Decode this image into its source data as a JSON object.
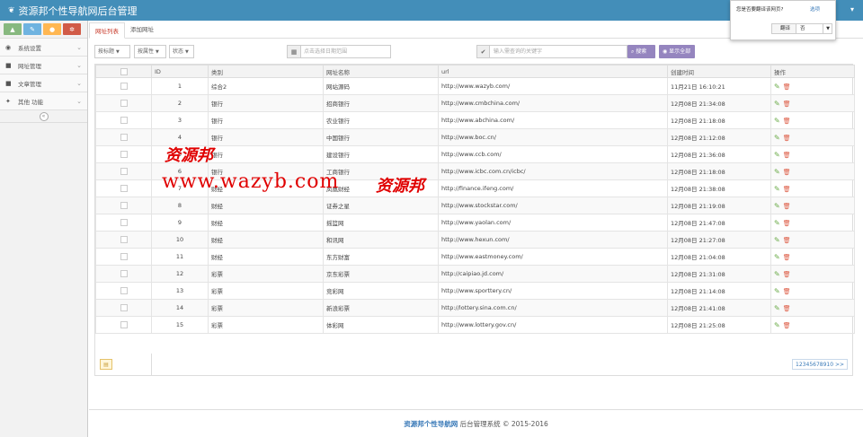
{
  "header": {
    "title": "资源邦个性导航网后台管理",
    "user_caret": "▾"
  },
  "sidebar": {
    "items": [
      {
        "label": "系统设置",
        "icon": "dashboard-icon"
      },
      {
        "label": "网址管理",
        "icon": "folder-icon"
      },
      {
        "label": "文章管理",
        "icon": "folder-icon"
      },
      {
        "label": "其他 功能",
        "icon": "wrench-icon"
      }
    ],
    "collapse_symbol": "«"
  },
  "tabs": [
    {
      "label": "网址列表",
      "active": true
    },
    {
      "label": "添加网址",
      "active": false
    }
  ],
  "filters": {
    "select1": "按标题",
    "select2": "按属性",
    "select3": "状态",
    "date_placeholder": "点击选择日期范围",
    "search_placeholder": "输入需查询的关键字",
    "search_button": "搜索",
    "show_all_button": "显示全部"
  },
  "table": {
    "headers": [
      "ID",
      "类别",
      "网址名称",
      "url",
      "创建时间",
      "操作"
    ],
    "rows": [
      {
        "id": "1",
        "cat": "综合2",
        "name": "网站源码",
        "url": "http://www.wazyb.com/",
        "time": "11月21日 16:10:21"
      },
      {
        "id": "2",
        "cat": "银行",
        "name": "招商银行",
        "url": "http://www.cmbchina.com/",
        "time": "12月08日 21:34:08"
      },
      {
        "id": "3",
        "cat": "银行",
        "name": "农业银行",
        "url": "http://www.abchina.com/",
        "time": "12月08日 21:18:08"
      },
      {
        "id": "4",
        "cat": "银行",
        "name": "中国银行",
        "url": "http://www.boc.cn/",
        "time": "12月08日 21:12:08"
      },
      {
        "id": "5",
        "cat": "银行",
        "name": "建设银行",
        "url": "http://www.ccb.com/",
        "time": "12月08日 21:36:08"
      },
      {
        "id": "6",
        "cat": "银行",
        "name": "工商银行",
        "url": "http://www.icbc.com.cn/icbc/",
        "time": "12月08日 21:18:08"
      },
      {
        "id": "7",
        "cat": "财经",
        "name": "凤凰财经",
        "url": "http://finance.ifeng.com/",
        "time": "12月08日 21:38:08"
      },
      {
        "id": "8",
        "cat": "财经",
        "name": "证券之星",
        "url": "http://www.stockstar.com/",
        "time": "12月08日 21:19:08"
      },
      {
        "id": "9",
        "cat": "财经",
        "name": "摇篮网",
        "url": "http://www.yaolan.com/",
        "time": "12月08日 21:47:08"
      },
      {
        "id": "10",
        "cat": "财经",
        "name": "和讯网",
        "url": "http://www.hexun.com/",
        "time": "12月08日 21:27:08"
      },
      {
        "id": "11",
        "cat": "财经",
        "name": "东方财富",
        "url": "http://www.eastmoney.com/",
        "time": "12月08日 21:04:08"
      },
      {
        "id": "12",
        "cat": "彩票",
        "name": "京东彩票",
        "url": "http://caipiao.jd.com/",
        "time": "12月08日 21:31:08"
      },
      {
        "id": "13",
        "cat": "彩票",
        "name": "竞彩网",
        "url": "http://www.sporttery.cn/",
        "time": "12月08日 21:14:08"
      },
      {
        "id": "14",
        "cat": "彩票",
        "name": "新浪彩票",
        "url": "http://lottery.sina.com.cn/",
        "time": "12月08日 21:41:08"
      },
      {
        "id": "15",
        "cat": "彩票",
        "name": "体彩网",
        "url": "http://www.lottery.gov.cn/",
        "time": "12月08日 21:25:08"
      }
    ]
  },
  "pager": "12345678910 >>",
  "footer": {
    "site": "资源邦个性导航网",
    "rest": "后台管理系统 © 2015-2016"
  },
  "watermark": {
    "url": "www.wazyb.com",
    "cn": "资源邦"
  },
  "translate_popup": {
    "question": "您是否要翻译该网页?",
    "option": "选项",
    "translate_button": "翻译",
    "no_select": "否"
  },
  "colors": {
    "header_bg": "#438eb9",
    "active_tab": "#c83a2a",
    "button_purple": "#9585bf",
    "edit_green": "#69aa46",
    "delete_red": "#dd5a43",
    "watermark_red": "#e00000"
  }
}
